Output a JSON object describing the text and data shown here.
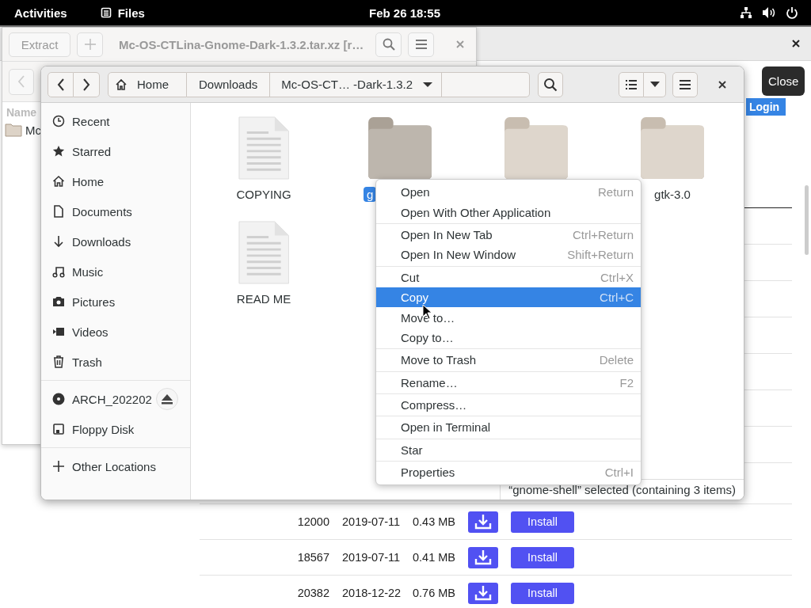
{
  "top_bar": {
    "activities": "Activities",
    "app": "Files",
    "clock": "Feb 26  18:55"
  },
  "browser": {
    "login": "Login",
    "rows": [
      {
        "downloads": "12000",
        "date": "2019-07-11",
        "size": "0.43 MB",
        "install": "Install"
      },
      {
        "downloads": "18567",
        "date": "2019-07-11",
        "size": "0.41 MB",
        "install": "Install"
      },
      {
        "downloads": "20382",
        "date": "2018-12-22",
        "size": "0.76 MB",
        "install": "Install"
      }
    ]
  },
  "archive_window": {
    "extract": "Extract",
    "title": "Mc-OS-CTLina-Gnome-Dark-1.3.2.tar.xz [r…",
    "column_header": "Name",
    "item": "Mc"
  },
  "files_window": {
    "path": [
      {
        "label": "Home",
        "kind": "home"
      },
      {
        "label": "Downloads",
        "kind": "folder"
      },
      {
        "label": "Mc-OS-CT… -Dark-1.3.2",
        "kind": "current"
      }
    ],
    "sidebar": [
      [
        {
          "label": "Recent",
          "kind": "recent"
        },
        {
          "label": "Starred",
          "kind": "starred"
        },
        {
          "label": "Home",
          "kind": "home"
        },
        {
          "label": "Documents",
          "kind": "documents"
        },
        {
          "label": "Downloads",
          "kind": "downloads"
        },
        {
          "label": "Music",
          "kind": "music"
        },
        {
          "label": "Pictures",
          "kind": "pictures"
        },
        {
          "label": "Videos",
          "kind": "videos"
        },
        {
          "label": "Trash",
          "kind": "trash"
        }
      ],
      [
        {
          "label": "ARCH_202202",
          "kind": "disc"
        },
        {
          "label": "Floppy Disk",
          "kind": "floppy"
        }
      ],
      [
        {
          "label": "Other Locations",
          "kind": "other"
        }
      ]
    ],
    "files": [
      {
        "name": "COPYING",
        "kind": "document",
        "selected": false
      },
      {
        "name": "g",
        "kind": "folder",
        "selected": true
      },
      {
        "kind": "folder",
        "selected": false
      },
      {
        "name": "gtk-3.0",
        "kind": "folder",
        "selected": false
      },
      {
        "name": "READ ME",
        "kind": "document",
        "selected": false
      }
    ],
    "status": "“gnome-shell” selected (containing 3 items)"
  },
  "context_menu": [
    [
      {
        "label": "Open",
        "shortcut": "Return",
        "selected": false
      },
      {
        "label": "Open With Other Application",
        "selected": false
      }
    ],
    [
      {
        "label": "Open In New Tab",
        "shortcut": "Ctrl+Return",
        "selected": false
      },
      {
        "label": "Open In New Window",
        "shortcut": "Shift+Return",
        "selected": false
      }
    ],
    [
      {
        "label": "Cut",
        "shortcut": "Ctrl+X",
        "selected": false
      },
      {
        "label": "Copy",
        "shortcut": "Ctrl+C",
        "selected": true
      },
      {
        "label": "Move to…",
        "selected": false
      },
      {
        "label": "Copy to…",
        "selected": false
      }
    ],
    [
      {
        "label": "Move to Trash",
        "shortcut": "Delete",
        "selected": false
      }
    ],
    [
      {
        "label": "Rename…",
        "shortcut": "F2",
        "selected": false
      }
    ],
    [
      {
        "label": "Compress…",
        "selected": false
      }
    ],
    [
      {
        "label": "Open in Terminal",
        "selected": false
      }
    ],
    [
      {
        "label": "Star",
        "selected": false
      }
    ],
    [
      {
        "label": "Properties",
        "shortcut": "Ctrl+I",
        "selected": false
      }
    ]
  ],
  "tooltip": "Close"
}
